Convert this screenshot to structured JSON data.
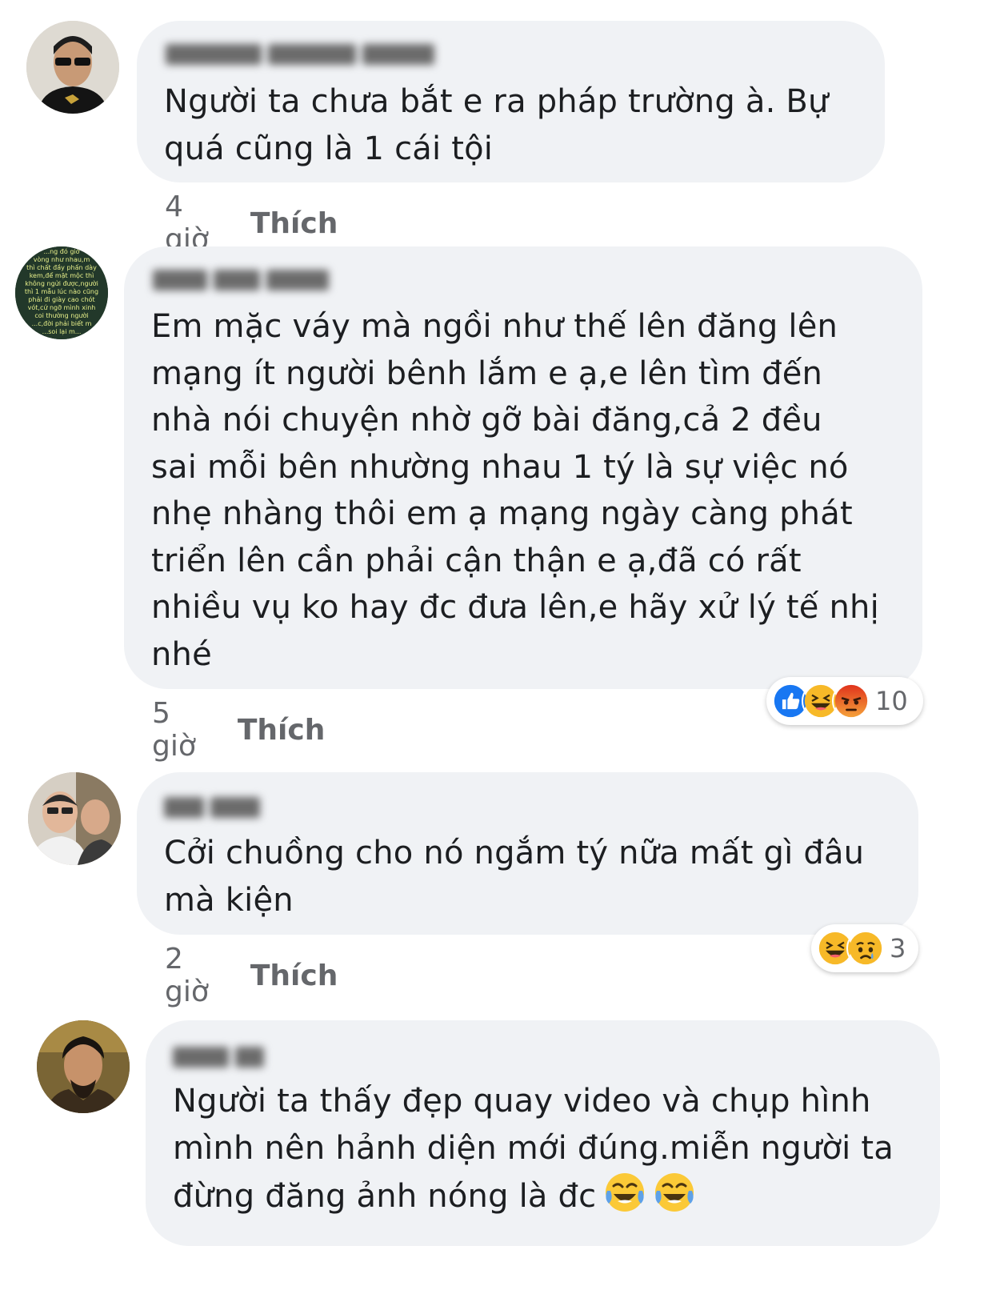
{
  "comments": [
    {
      "text": "Người ta chưa bắt e ra pháp trường à. Bự\nquá cũng là 1 cái tội",
      "time": "4 giờ",
      "like_label": "Thích"
    },
    {
      "text": "Em mặc váy mà ngồi như thế lên đăng lên\nmạng ít người bênh lắm e ạ,e lên tìm đến\nnhà nói chuyện nhờ gỡ bài đăng,cả 2 đều\nsai mỗi bên nhường nhau 1 tý là sự việc nó\nnhẹ nhàng thôi em ạ mạng ngày càng phát\ntriển lên cần phải cận thận e ạ,đã có rất\nnhiều vụ ko hay đc đưa lên,e hãy xử lý tế nhị\nnhé",
      "time": "5 giờ",
      "like_label": "Thích",
      "reactions": [
        "like",
        "haha",
        "angry"
      ],
      "reaction_count": "10",
      "avatar_text": "...ng đó giờ\nvòng như nhau,m\nthì chất đầy phấn dày\nkem,để mặt mộc thì\nkhông ngửi được,người\nthì 1 mẫu lúc nào cũng\nphải đi giày cao chót\nvót,cứ ngỡ mình xinh\ncoi thường người\n...c,đời phải biết m\n...soi lại m..."
    },
    {
      "text": "Cởi chuồng cho nó ngắm tý nữa mất gì đâu\nmà kiện",
      "time": "2 giờ",
      "like_label": "Thích",
      "reactions": [
        "haha",
        "sad"
      ],
      "reaction_count": "3"
    },
    {
      "text": "Người ta thấy đẹp quay video và chụp hình\nmình nên hảnh diện mới đúng.miễn người ta\nđừng đăng ảnh nóng là đc",
      "emoji": [
        "joy-emoji",
        "joy-emoji"
      ]
    }
  ],
  "colors": {
    "bubble": "#f0f2f5",
    "meta_text": "#65676b",
    "like_blue": "#1877f2",
    "haha_yellow": "#f7b928",
    "angry_orange": "#e9710f"
  }
}
